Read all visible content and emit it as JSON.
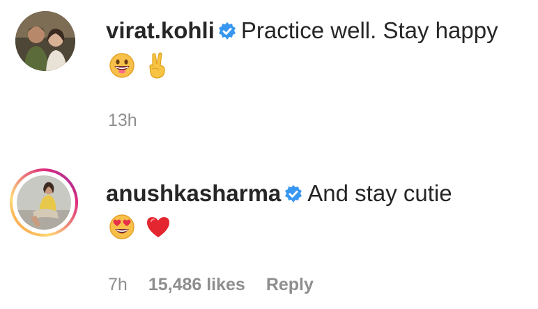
{
  "comments": [
    {
      "username": "virat.kohli",
      "verified": true,
      "text": "Practice well. Stay happy",
      "emojis": [
        "grinning-face",
        "victory-hand"
      ],
      "time": "13h"
    },
    {
      "username": "anushkasharma",
      "verified": true,
      "text": "And stay cutie",
      "emojis": [
        "heart-eyes-face",
        "red-heart"
      ],
      "time": "7h",
      "likes": "15,486 likes",
      "reply_label": "Reply"
    }
  ],
  "colors": {
    "verified_badge": "#3897f0",
    "meta_text": "#8e8e8e",
    "story_ring_start": "#f58529",
    "story_ring_end": "#dd2a7b"
  }
}
